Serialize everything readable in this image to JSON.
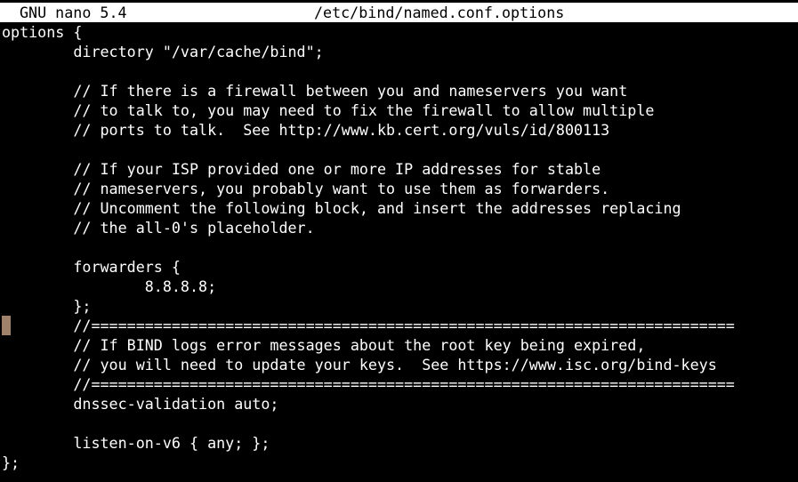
{
  "titlebar": {
    "app": "GNU nano 5.4",
    "file": "/etc/bind/named.conf.options"
  },
  "editor": {
    "lines": [
      "options {",
      "        directory \"/var/cache/bind\";",
      "",
      "        // If there is a firewall between you and nameservers you want",
      "        // to talk to, you may need to fix the firewall to allow multiple",
      "        // ports to talk.  See http://www.kb.cert.org/vuls/id/800113",
      "",
      "        // If your ISP provided one or more IP addresses for stable",
      "        // nameservers, you probably want to use them as forwarders.",
      "        // Uncomment the following block, and insert the addresses replacing",
      "        // the all-0's placeholder.",
      "",
      "        forwarders {",
      "                8.8.8.8;",
      "        };",
      "        //========================================================================",
      "        // If BIND logs error messages about the root key being expired,",
      "        // you will need to update your keys.  See https://www.isc.org/bind-keys",
      "        //========================================================================",
      "        dnssec-validation auto;",
      "",
      "        listen-on-v6 { any; };",
      "};"
    ]
  },
  "colors": {
    "background": "#000000",
    "text": "#ffffff",
    "titlebar_background": "#ffffff",
    "titlebar_text": "#000000",
    "cursor": "#a0826a"
  }
}
